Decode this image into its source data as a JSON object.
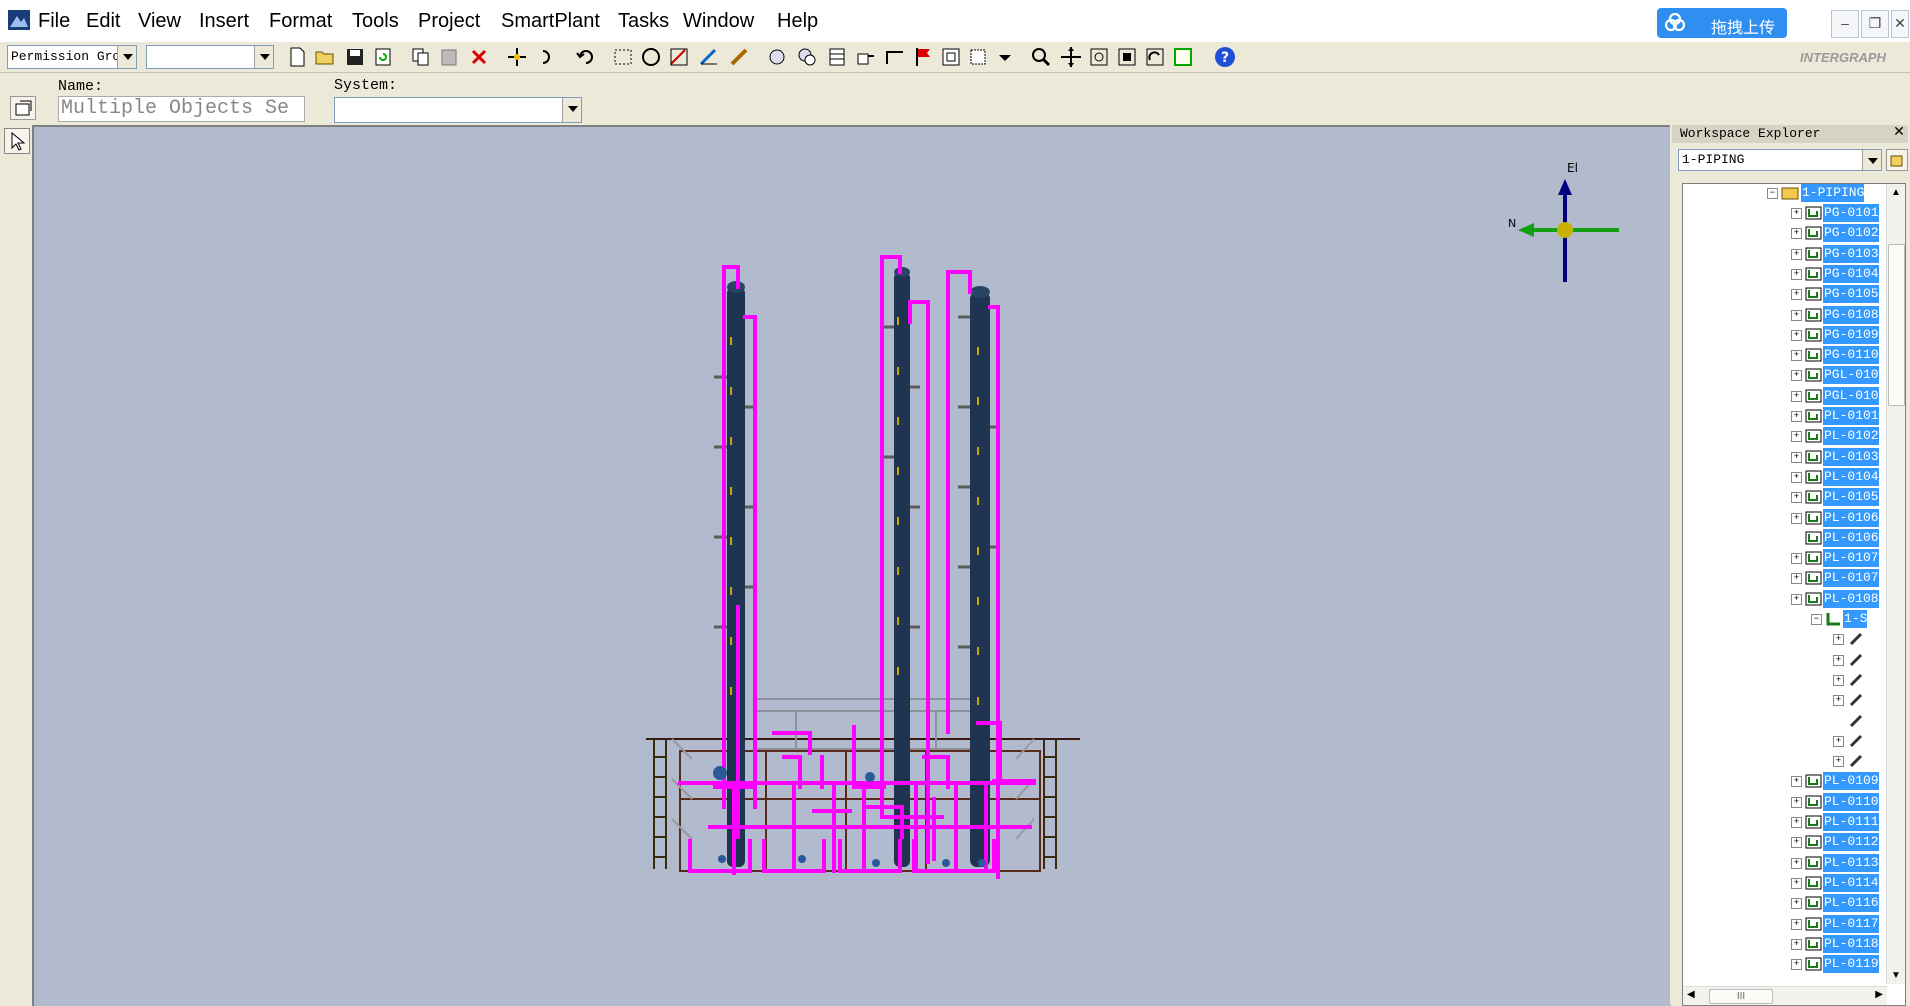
{
  "menu": {
    "items": [
      "File",
      "Edit",
      "View",
      "Insert",
      "Format",
      "Tools",
      "Project",
      "SmartPlant",
      "Tasks",
      "Window",
      "Help"
    ],
    "upload_label": "拖拽上传"
  },
  "toolbar": {
    "permission_group": "Permission Grc",
    "filter_value": ""
  },
  "properties": {
    "name_label": "Name:",
    "name_value": "Multiple Objects Se",
    "system_label": "System:",
    "system_value": ""
  },
  "brand": {
    "logo_text": "INTERGRAPH"
  },
  "compass": {
    "up_label": "El",
    "left_label": "N"
  },
  "explorer": {
    "title": "Workspace Explorer",
    "filter_value": "1-PIPING",
    "root": "1-PIPING",
    "items": [
      "PG-0101",
      "PG-0102",
      "PG-0103",
      "PG-0104",
      "PG-0105",
      "PG-0108",
      "PG-0109",
      "PG-0110",
      "PGL-010",
      "PGL-010",
      "PL-0101",
      "PL-0102",
      "PL-0103",
      "PL-0104",
      "PL-0105",
      "PL-0106",
      "PL-0106",
      "PL-0107",
      "PL-0107",
      "PL-0108"
    ],
    "expanded_child": "1-S",
    "items_after": [
      "PL-0109",
      "PL-0110",
      "PL-0111",
      "PL-0112",
      "PL-0113",
      "PL-0114",
      "PL-0116",
      "PL-0117",
      "PL-0118",
      "PL-0119"
    ],
    "hscroll_label": "III"
  },
  "colors": {
    "pipe": "#ff00ff",
    "column": "#1f3450",
    "viewport": "#b2bacd",
    "selection": "#3399ff"
  }
}
